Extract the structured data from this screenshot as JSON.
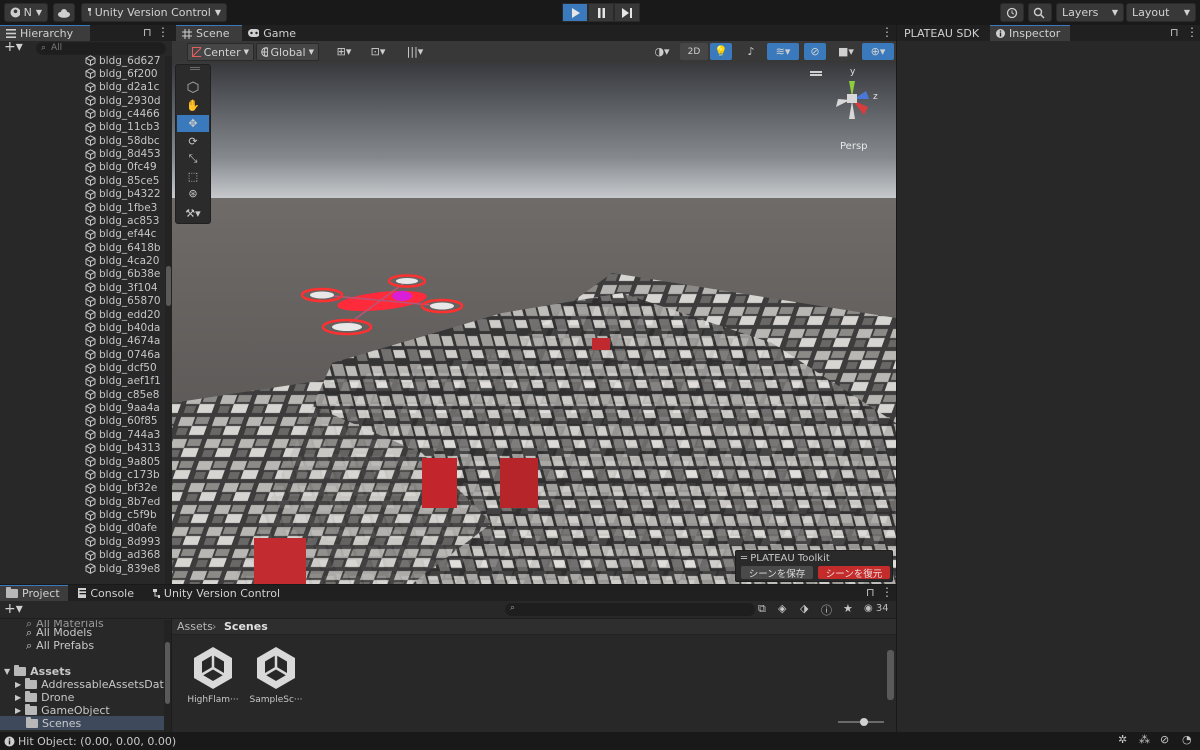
{
  "toolbar": {
    "account_label": "N",
    "vcs_label": "Unity Version Control",
    "layers_label": "Layers",
    "layout_label": "Layout"
  },
  "hierarchy": {
    "tab_label": "Hierarchy",
    "search_placeholder": "All",
    "items": [
      "bldg_6d627",
      "bldg_6f200",
      "bldg_d2a1c",
      "bldg_2930d",
      "bldg_c4466",
      "bldg_11cb3",
      "bldg_58dbc",
      "bldg_8d453",
      "bldg_0fc49",
      "bldg_85ce5",
      "bldg_b4322",
      "bldg_1fbe3",
      "bldg_ac853",
      "bldg_ef44c",
      "bldg_6418b",
      "bldg_4ca20",
      "bldg_6b38e",
      "bldg_3f104",
      "bldg_65870",
      "bldg_edd20",
      "bldg_b40da",
      "bldg_4674a",
      "bldg_0746a",
      "bldg_dcf50",
      "bldg_aef1f1",
      "bldg_c85e8",
      "bldg_9aa4a",
      "bldg_60f85",
      "bldg_744a3",
      "bldg_b4313",
      "bldg_9a805",
      "bldg_c173b",
      "bldg_bf32e",
      "bldg_8b7ed",
      "bldg_c5f9b",
      "bldg_d0afe",
      "bldg_8d993",
      "bldg_ad368",
      "bldg_839e8"
    ]
  },
  "scene": {
    "tab_scene": "Scene",
    "tab_game": "Game",
    "pivot_label": "Center",
    "space_label": "Global",
    "mode_2d": "2D",
    "persp_label": "Persp",
    "gizmo_y": "y",
    "gizmo_z": "z"
  },
  "overlay": {
    "title": "PLATEAU Toolkit",
    "save_label": "シーンを保存",
    "restore_label": "シーンを復元"
  },
  "right_panel": {
    "tab_plateau": "PLATEAU SDK",
    "tab_inspector": "Inspector"
  },
  "project": {
    "tab_project": "Project",
    "tab_console": "Console",
    "tab_vcs": "Unity Version Control",
    "favorites": [
      "All Materials",
      "All Models",
      "All Prefabs"
    ],
    "root": "Assets",
    "folders": [
      "AddressableAssetsData",
      "Drone",
      "GameObject",
      "Scenes"
    ],
    "breadcrumb_root": "Assets",
    "breadcrumb_current": "Scenes",
    "hidden_count": "34",
    "assets": [
      "HighFlam···",
      "SampleSc···"
    ]
  },
  "status": {
    "text": "Hit Object: (0.00, 0.00, 0.00)"
  },
  "colors": {
    "accent": "#3a79bb",
    "drone": "#ff2a3a",
    "restore_button": "#c42b2b"
  }
}
